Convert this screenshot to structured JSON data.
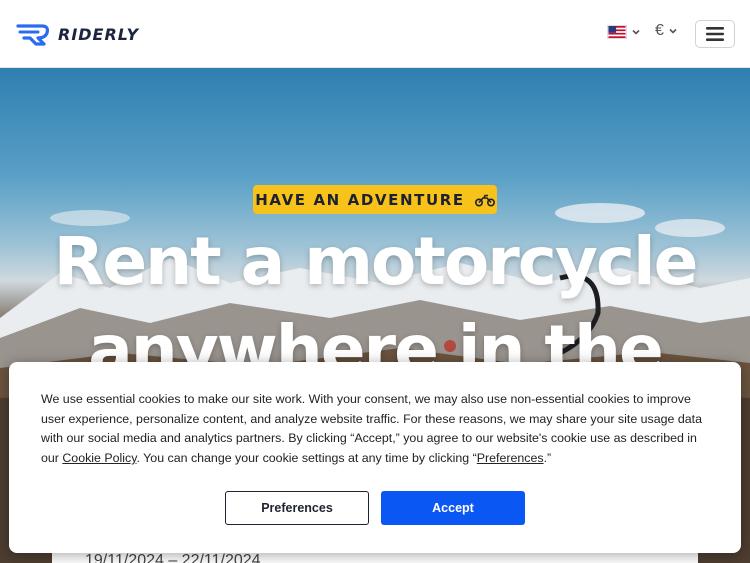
{
  "header": {
    "brand": "RIDERLY",
    "language": "en-US",
    "currency": "€"
  },
  "hero": {
    "badge": "HAVE AN ADVENTURE",
    "headline_line1": "Rent a motorcycle",
    "headline_line2": "anywhere in the",
    "date_range": "19/11/2024 – 22/11/2024"
  },
  "cookie": {
    "text_1": "We use essential cookies to make our site work. With your consent, we may also use non-essential cookies to improve user experience, personalize content, and analyze website traffic. For these reasons, we may share your site usage data with our social media and analytics partners. By clicking “Accept,” you agree to our website's cookie use as described in our ",
    "cookie_policy_link": "Cookie Policy",
    "text_2": ". You can change your cookie settings at any time by clicking “",
    "preferences_link": "Preferences",
    "text_3": ".”",
    "preferences_button": "Preferences",
    "accept_button": "Accept"
  },
  "colors": {
    "brand_blue": "#2a6bf0",
    "badge_yellow": "#f7c21a",
    "accept_blue": "#0a57f4"
  },
  "icons": [
    "riderly-logo-icon",
    "us-flag-icon",
    "chevron-down-icon",
    "hamburger-menu-icon",
    "motorcycle-icon"
  ]
}
